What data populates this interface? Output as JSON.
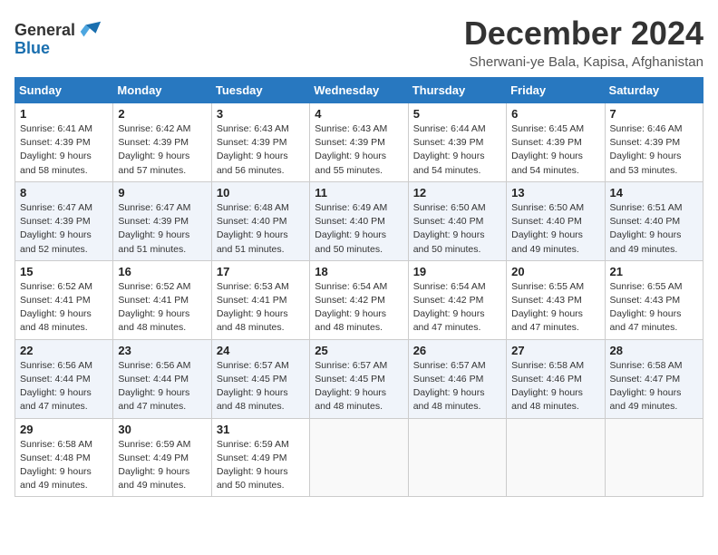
{
  "logo": {
    "line1": "General",
    "line2": "Blue"
  },
  "title": "December 2024",
  "subtitle": "Sherwani-ye Bala, Kapisa, Afghanistan",
  "headers": [
    "Sunday",
    "Monday",
    "Tuesday",
    "Wednesday",
    "Thursday",
    "Friday",
    "Saturday"
  ],
  "weeks": [
    [
      {
        "day": "1",
        "info": "Sunrise: 6:41 AM\nSunset: 4:39 PM\nDaylight: 9 hours\nand 58 minutes."
      },
      {
        "day": "2",
        "info": "Sunrise: 6:42 AM\nSunset: 4:39 PM\nDaylight: 9 hours\nand 57 minutes."
      },
      {
        "day": "3",
        "info": "Sunrise: 6:43 AM\nSunset: 4:39 PM\nDaylight: 9 hours\nand 56 minutes."
      },
      {
        "day": "4",
        "info": "Sunrise: 6:43 AM\nSunset: 4:39 PM\nDaylight: 9 hours\nand 55 minutes."
      },
      {
        "day": "5",
        "info": "Sunrise: 6:44 AM\nSunset: 4:39 PM\nDaylight: 9 hours\nand 54 minutes."
      },
      {
        "day": "6",
        "info": "Sunrise: 6:45 AM\nSunset: 4:39 PM\nDaylight: 9 hours\nand 54 minutes."
      },
      {
        "day": "7",
        "info": "Sunrise: 6:46 AM\nSunset: 4:39 PM\nDaylight: 9 hours\nand 53 minutes."
      }
    ],
    [
      {
        "day": "8",
        "info": "Sunrise: 6:47 AM\nSunset: 4:39 PM\nDaylight: 9 hours\nand 52 minutes."
      },
      {
        "day": "9",
        "info": "Sunrise: 6:47 AM\nSunset: 4:39 PM\nDaylight: 9 hours\nand 51 minutes."
      },
      {
        "day": "10",
        "info": "Sunrise: 6:48 AM\nSunset: 4:40 PM\nDaylight: 9 hours\nand 51 minutes."
      },
      {
        "day": "11",
        "info": "Sunrise: 6:49 AM\nSunset: 4:40 PM\nDaylight: 9 hours\nand 50 minutes."
      },
      {
        "day": "12",
        "info": "Sunrise: 6:50 AM\nSunset: 4:40 PM\nDaylight: 9 hours\nand 50 minutes."
      },
      {
        "day": "13",
        "info": "Sunrise: 6:50 AM\nSunset: 4:40 PM\nDaylight: 9 hours\nand 49 minutes."
      },
      {
        "day": "14",
        "info": "Sunrise: 6:51 AM\nSunset: 4:40 PM\nDaylight: 9 hours\nand 49 minutes."
      }
    ],
    [
      {
        "day": "15",
        "info": "Sunrise: 6:52 AM\nSunset: 4:41 PM\nDaylight: 9 hours\nand 48 minutes."
      },
      {
        "day": "16",
        "info": "Sunrise: 6:52 AM\nSunset: 4:41 PM\nDaylight: 9 hours\nand 48 minutes."
      },
      {
        "day": "17",
        "info": "Sunrise: 6:53 AM\nSunset: 4:41 PM\nDaylight: 9 hours\nand 48 minutes."
      },
      {
        "day": "18",
        "info": "Sunrise: 6:54 AM\nSunset: 4:42 PM\nDaylight: 9 hours\nand 48 minutes."
      },
      {
        "day": "19",
        "info": "Sunrise: 6:54 AM\nSunset: 4:42 PM\nDaylight: 9 hours\nand 47 minutes."
      },
      {
        "day": "20",
        "info": "Sunrise: 6:55 AM\nSunset: 4:43 PM\nDaylight: 9 hours\nand 47 minutes."
      },
      {
        "day": "21",
        "info": "Sunrise: 6:55 AM\nSunset: 4:43 PM\nDaylight: 9 hours\nand 47 minutes."
      }
    ],
    [
      {
        "day": "22",
        "info": "Sunrise: 6:56 AM\nSunset: 4:44 PM\nDaylight: 9 hours\nand 47 minutes."
      },
      {
        "day": "23",
        "info": "Sunrise: 6:56 AM\nSunset: 4:44 PM\nDaylight: 9 hours\nand 47 minutes."
      },
      {
        "day": "24",
        "info": "Sunrise: 6:57 AM\nSunset: 4:45 PM\nDaylight: 9 hours\nand 48 minutes."
      },
      {
        "day": "25",
        "info": "Sunrise: 6:57 AM\nSunset: 4:45 PM\nDaylight: 9 hours\nand 48 minutes."
      },
      {
        "day": "26",
        "info": "Sunrise: 6:57 AM\nSunset: 4:46 PM\nDaylight: 9 hours\nand 48 minutes."
      },
      {
        "day": "27",
        "info": "Sunrise: 6:58 AM\nSunset: 4:46 PM\nDaylight: 9 hours\nand 48 minutes."
      },
      {
        "day": "28",
        "info": "Sunrise: 6:58 AM\nSunset: 4:47 PM\nDaylight: 9 hours\nand 49 minutes."
      }
    ],
    [
      {
        "day": "29",
        "info": "Sunrise: 6:58 AM\nSunset: 4:48 PM\nDaylight: 9 hours\nand 49 minutes."
      },
      {
        "day": "30",
        "info": "Sunrise: 6:59 AM\nSunset: 4:49 PM\nDaylight: 9 hours\nand 49 minutes."
      },
      {
        "day": "31",
        "info": "Sunrise: 6:59 AM\nSunset: 4:49 PM\nDaylight: 9 hours\nand 50 minutes."
      },
      {
        "day": "",
        "info": ""
      },
      {
        "day": "",
        "info": ""
      },
      {
        "day": "",
        "info": ""
      },
      {
        "day": "",
        "info": ""
      }
    ]
  ]
}
